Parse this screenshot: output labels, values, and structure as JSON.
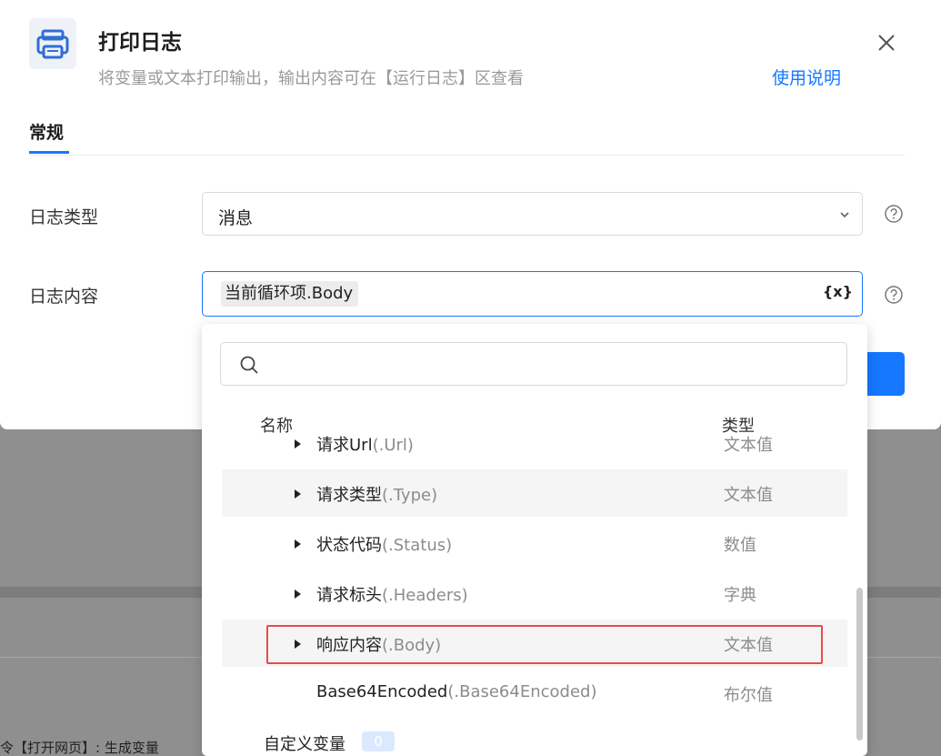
{
  "background": {
    "bottom_text": "令【打开网页】: 生成变量"
  },
  "dialog": {
    "title": "打印日志",
    "subtitle": "将变量或文本打印输出，输出内容可在【运行日志】区查看",
    "help_link": "使用说明",
    "icon": "printer-icon",
    "tabs": [
      {
        "label": "常规",
        "active": true
      }
    ],
    "fields": {
      "log_type": {
        "label": "日志类型",
        "value": "消息"
      },
      "log_content": {
        "label": "日志内容",
        "chip": "当前循环项.Body",
        "var_button": "{x}"
      }
    }
  },
  "dropdown": {
    "search": {
      "placeholder": ""
    },
    "headers": {
      "name": "名称",
      "type": "类型"
    },
    "rows": [
      {
        "name": "请求Url",
        "prop": "(.Url)",
        "type": "文本值",
        "arrow": true,
        "partial": true
      },
      {
        "name": "请求类型",
        "prop": "(.Type)",
        "type": "文本值",
        "arrow": true
      },
      {
        "name": "状态代码",
        "prop": "(.Status)",
        "type": "数值",
        "arrow": true
      },
      {
        "name": "请求标头",
        "prop": "(.Headers)",
        "type": "字典",
        "arrow": true
      },
      {
        "name": "响应内容",
        "prop": "(.Body)",
        "type": "文本值",
        "arrow": true,
        "highlighted": true
      },
      {
        "name": "Base64Encoded",
        "prop": "(.Base64Encoded)",
        "type": "布尔值",
        "arrow": false
      }
    ],
    "custom_vars": {
      "label": "自定义变量",
      "count": "0"
    }
  },
  "colors": {
    "accent": "#1677ff",
    "highlight": "#e74c4c"
  }
}
